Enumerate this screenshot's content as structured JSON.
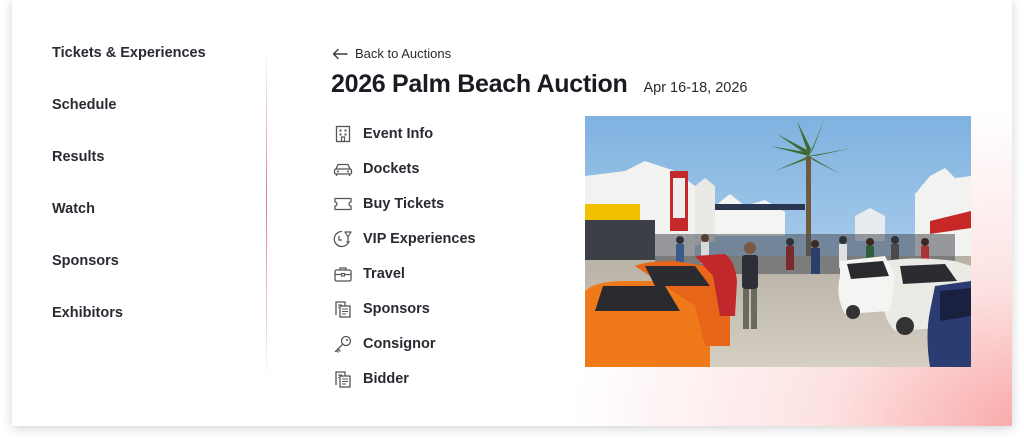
{
  "sidebar": {
    "items": [
      {
        "label": "Tickets & Experiences"
      },
      {
        "label": "Schedule"
      },
      {
        "label": "Results"
      },
      {
        "label": "Watch"
      },
      {
        "label": "Sponsors"
      },
      {
        "label": "Exhibitors"
      }
    ]
  },
  "header": {
    "back_label": "Back to Auctions",
    "title": "2026 Palm Beach Auction",
    "date": "Apr 16-18, 2026"
  },
  "menu": {
    "items": [
      {
        "label": "Event Info",
        "icon": "building-icon"
      },
      {
        "label": "Dockets",
        "icon": "car-icon"
      },
      {
        "label": "Buy Tickets",
        "icon": "ticket-icon"
      },
      {
        "label": "VIP Experiences",
        "icon": "vip-glass-icon"
      },
      {
        "label": "Travel",
        "icon": "briefcase-icon"
      },
      {
        "label": "Sponsors",
        "icon": "document-icon"
      },
      {
        "label": "Consignor",
        "icon": "key-icon"
      },
      {
        "label": "Bidder",
        "icon": "document-icon"
      }
    ]
  },
  "hero_image": {
    "description_icon": "auction-crowd-photo"
  },
  "colors": {
    "accent": "#c62828",
    "text": "#2a2a33",
    "glow": "#f8a0a0"
  }
}
